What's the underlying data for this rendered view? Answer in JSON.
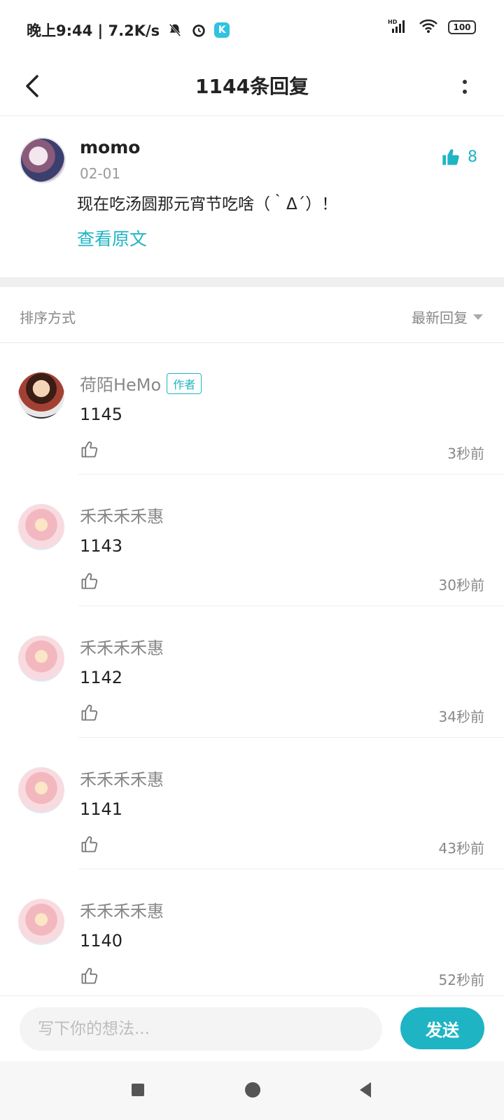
{
  "status_bar": {
    "time_speed": "晚上9:44 | 7.2K/s",
    "k_badge": "K",
    "battery": "100",
    "signal_label": "HD"
  },
  "header": {
    "title": "1144条回复"
  },
  "post": {
    "author": "momo",
    "date": "02-01",
    "likes": "8",
    "content": "现在吃汤圆那元宵节吃啥（｀Δ´）！",
    "view_original": "查看原文"
  },
  "sort": {
    "label": "排序方式",
    "selected": "最新回复"
  },
  "replies": [
    {
      "author": "荷陌HeMo",
      "badge": "作者",
      "text": "1145",
      "time": "3秒前"
    },
    {
      "author": "禾禾禾禾惠",
      "text": "1143",
      "time": "30秒前"
    },
    {
      "author": "禾禾禾禾惠",
      "text": "1142",
      "time": "34秒前"
    },
    {
      "author": "禾禾禾禾惠",
      "text": "1141",
      "time": "43秒前"
    },
    {
      "author": "禾禾禾禾惠",
      "text": "1140",
      "time": "52秒前"
    }
  ],
  "input": {
    "placeholder": "写下你的想法...",
    "send_label": "发送"
  },
  "colors": {
    "accent": "#1fb4c4"
  }
}
